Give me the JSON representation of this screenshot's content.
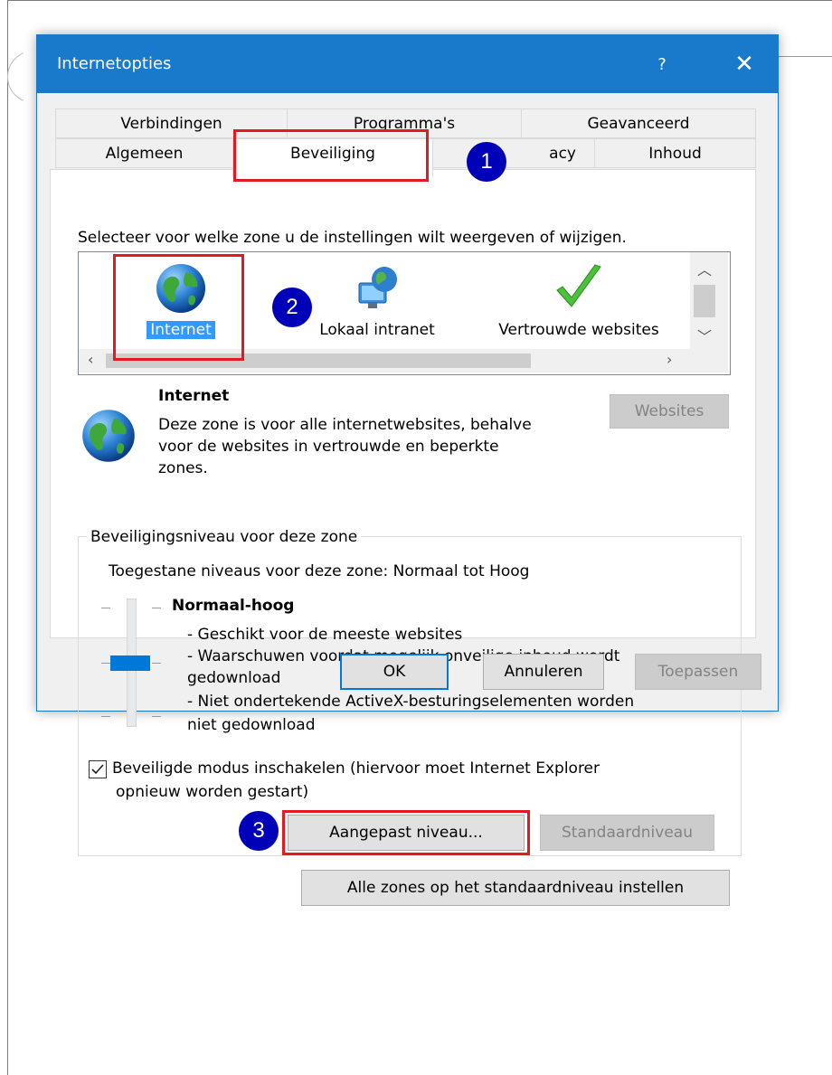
{
  "dialog": {
    "title": "Internetopties",
    "help_label": "?",
    "close_label": "✕"
  },
  "tabs": {
    "row1": [
      "Verbindingen",
      "Programma's",
      "Geavanceerd"
    ],
    "row2": [
      "Algemeen",
      "Beveiliging",
      "acy",
      "Inhoud"
    ],
    "active": "Beveiliging"
  },
  "zones": {
    "prompt": "Selecteer voor welke zone u de instellingen wilt weergeven of wijzigen.",
    "items": [
      {
        "label": "Internet",
        "icon": "globe-icon",
        "selected": true
      },
      {
        "label": "Lokaal intranet",
        "icon": "intranet-icon",
        "selected": false
      },
      {
        "label": "Vertrouwde websites",
        "icon": "checkmark-icon",
        "selected": false
      }
    ]
  },
  "zone_info": {
    "name": "Internet",
    "description": [
      "Deze zone is voor alle internetwebsites, behalve",
      "voor de websites in vertrouwde en beperkte",
      "zones."
    ],
    "websites_button": "Websites"
  },
  "security_level": {
    "legend": "Beveiligingsniveau voor deze zone",
    "allowed": "Toegestane niveaus voor deze zone: Normaal tot Hoog",
    "level_name": "Normaal-hoog",
    "slider_level": "middle",
    "bullets": [
      "- Geschikt voor de meeste websites",
      "- Waarschuwen voordat mogelijk onveilige inhoud wordt",
      "gedownload",
      "- Niet ondertekende ActiveX-besturingselementen worden",
      "niet gedownload"
    ]
  },
  "protected_mode": {
    "checked": true,
    "label_line1": "Beveiligde modus inschakelen (hiervoor moet Internet Explorer",
    "label_line2": "opnieuw worden gestart)"
  },
  "buttons": {
    "custom_level": "Aangepast niveau...",
    "default_level": "Standaardniveau",
    "reset_all": "Alle zones op het standaardniveau instellen",
    "ok": "OK",
    "cancel": "Annuleren",
    "apply": "Toepassen"
  },
  "annotations": {
    "badges": [
      "1",
      "2",
      "3"
    ],
    "highlight_color": "#e21b23",
    "badge_color": "#0000b8"
  }
}
